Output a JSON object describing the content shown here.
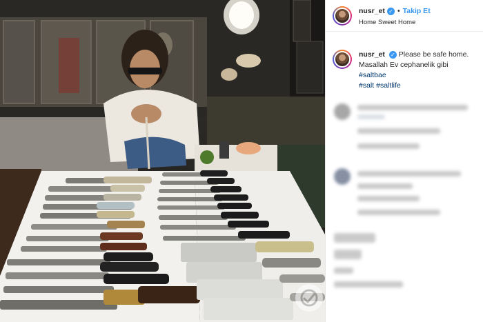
{
  "post": {
    "username": "nusr_et",
    "follow_label": "Takip Et",
    "location": "Home Sweet Home",
    "caption": {
      "username": "nusr_et",
      "line1": "Please be safe home.",
      "line2": "Masallah Ev cephanelik gibi",
      "tags": [
        "#saltbae",
        "#salt",
        "#saltlife"
      ]
    }
  },
  "icons": {
    "verified": "verified-badge-icon",
    "avatar": "profile-avatar"
  },
  "colors": {
    "link_blue": "#3897f0",
    "hashtag_blue": "#00376b",
    "text": "#262626"
  }
}
